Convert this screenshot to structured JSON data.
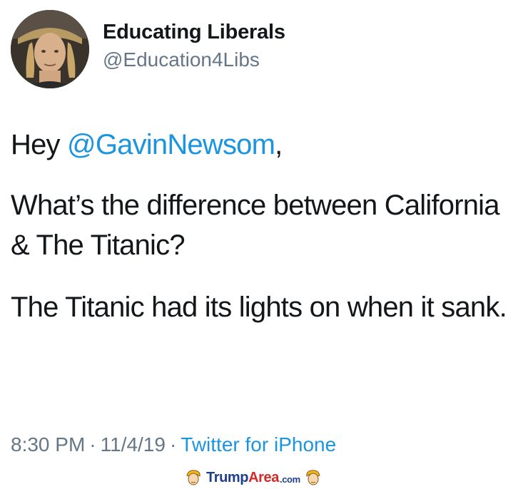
{
  "tweet": {
    "author": {
      "name": "Educating Liberals",
      "handle": "@Education4Libs"
    },
    "text": {
      "greeting_prefix": "Hey ",
      "mention": "@GavinNewsom",
      "greeting_suffix": ",",
      "question": "What’s the difference between California & The Titanic?",
      "answer": "The Titanic had its lights on when it sank."
    },
    "meta": {
      "time": "8:30 PM",
      "separator": "·",
      "date": "11/4/19",
      "source": "Twitter for iPhone"
    }
  },
  "watermark": {
    "brand_part1": "Trump",
    "brand_part2": "Area",
    "brand_suffix": ".com"
  },
  "colors": {
    "link": "#1b95e0",
    "text": "#14171a",
    "muted": "#657786",
    "watermark_blue": "#1f3f8a",
    "watermark_red": "#d42a2a"
  },
  "icons": {
    "avatar": "profile-photo",
    "watermark": "trump-head-icon"
  }
}
